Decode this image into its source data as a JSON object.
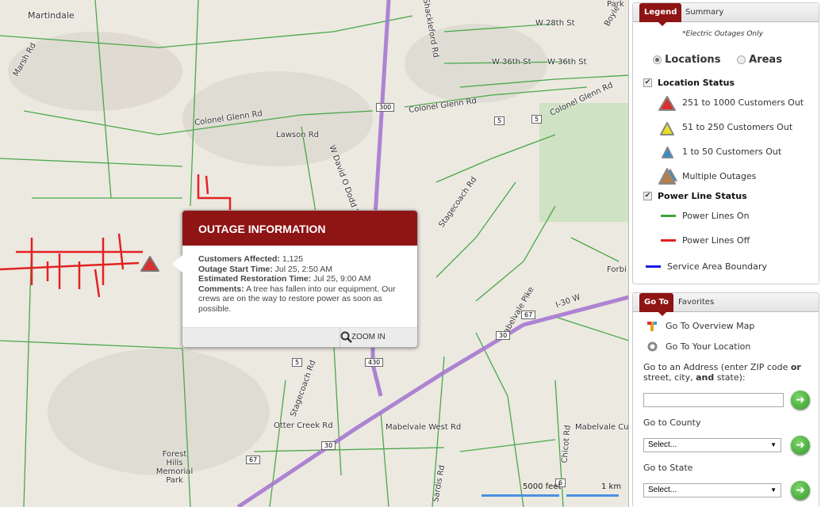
{
  "map": {
    "labels": {
      "martindale": "Martindale",
      "marsh_rd": "Marsh Rd",
      "colonel_glenn_w": "Colonel Glenn Rd",
      "colonel_glenn_c": "Colonel Glenn Rd",
      "colonel_glenn_e": "Colonel Glenn Rd",
      "lawson_rd": "Lawson Rd",
      "david_o_dodd": "W David O Dodd Rd",
      "stagecoach_n": "Stagecoach Rd",
      "stagecoach_s": "Stagecoach Rd",
      "shackleford": "Shackleford Rd",
      "w28": "W 28th St",
      "w36a": "W 36th St",
      "w36b": "W 36th St",
      "boyle": "Boyle",
      "park": "Park",
      "i30w": "I-30 W",
      "mabelvale_pike": "Mabelvale Pike",
      "otter_creek": "Otter Creek Rd",
      "mabelvale_west": "Mabelvale West Rd",
      "mabelvale_cut": "Mabelvale Cut Rd",
      "chicot": "Chicot Rd",
      "sardis": "Sardis Rd",
      "forest_hills": "Forest Hills Memorial Park",
      "forbi": "Forbi"
    },
    "shields": [
      "300",
      "5",
      "5",
      "67",
      "430",
      "30",
      "30",
      "5",
      "67",
      "6"
    ],
    "scale": {
      "feet": "5000 feet",
      "km": "1 km"
    },
    "colors": {
      "power_on": "#3aa63a",
      "power_off": "#e32222",
      "highway": "#a678d0",
      "boundary": "#1a1ae0"
    }
  },
  "popup": {
    "title": "OUTAGE INFORMATION",
    "customers_label": "Customers Affected:",
    "customers_value": "1,125",
    "start_label": "Outage Start Time:",
    "start_value": "Jul 25, 2:50 AM",
    "restore_label": "Estimated Restoration Time:",
    "restore_value": "Jul 25, 9:00 AM",
    "comments_label": "Comments:",
    "comments_value": "A tree has fallen into our equipment. Our crews are on the way to restore power as soon as possible.",
    "zoom_in": "ZOOM IN",
    "status_icon": "red-triangle"
  },
  "legend": {
    "tabs": [
      "Legend",
      "Summary"
    ],
    "note": "*Electric Outages Only",
    "view_options": [
      {
        "label": "Locations",
        "selected": true
      },
      {
        "label": "Areas",
        "selected": false
      }
    ],
    "location_status": {
      "label": "Location Status",
      "checked": true
    },
    "location_items": [
      {
        "label": "251 to 1000 Customers Out",
        "color": "#d93030"
      },
      {
        "label": "51 to 250 Customers Out",
        "color": "#e8e020"
      },
      {
        "label": "1 to 50 Customers Out",
        "color": "#2a8fd0"
      },
      {
        "label": "Multiple Outages",
        "color": "#b08050"
      }
    ],
    "power_line_status": {
      "label": "Power Line Status",
      "checked": true
    },
    "line_items": [
      {
        "label": "Power Lines On",
        "color": "#3aa63a"
      },
      {
        "label": "Power Lines Off",
        "color": "#e32222"
      },
      {
        "label": "Service Area Boundary",
        "color": "#1a1ae0"
      }
    ]
  },
  "goto": {
    "tabs": [
      "Go To",
      "Favorites"
    ],
    "overview": "Go To Overview Map",
    "location": "Go To Your Location",
    "address_label_1": "Go to an Address (enter ZIP code ",
    "address_or": "or",
    "address_label_2": "street, city, ",
    "address_and": "and",
    "address_label_3": " state):",
    "address_value": "",
    "county_label": "Go to County",
    "county_value": "Select...",
    "state_label": "Go to State",
    "state_value": "Select..."
  }
}
